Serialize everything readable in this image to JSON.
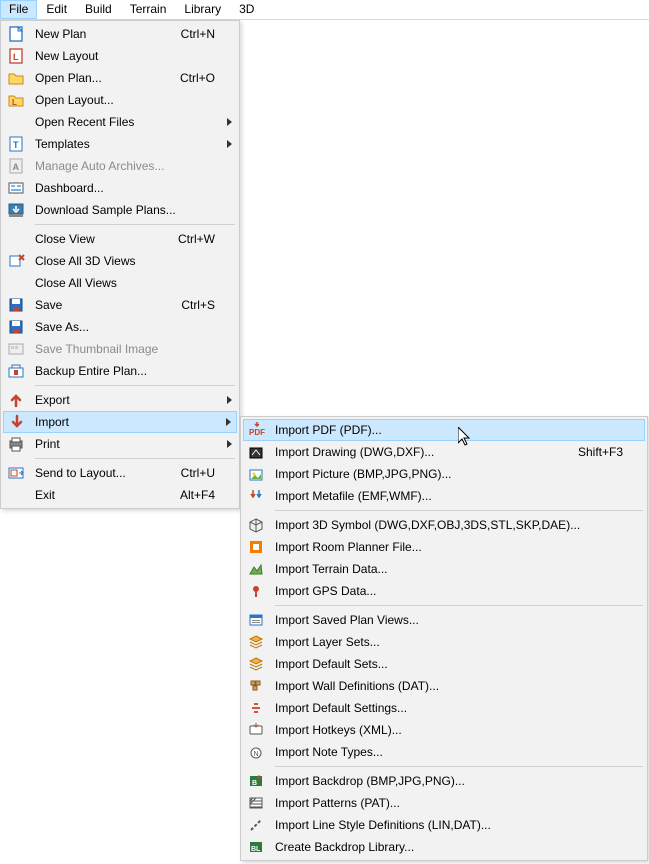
{
  "menubar": [
    "File",
    "Edit",
    "Build",
    "Terrain",
    "Library",
    "3D"
  ],
  "activeMenu": 0,
  "fileMenu": [
    {
      "t": "item",
      "icon": "new-plan",
      "label": "New Plan",
      "sc": "Ctrl+N"
    },
    {
      "t": "item",
      "icon": "new-layout",
      "label": "New Layout"
    },
    {
      "t": "item",
      "icon": "open-plan",
      "label": "Open Plan...",
      "sc": "Ctrl+O"
    },
    {
      "t": "item",
      "icon": "open-layout",
      "label": "Open Layout..."
    },
    {
      "t": "item",
      "label": "Open Recent Files",
      "sub": true
    },
    {
      "t": "item",
      "icon": "templates",
      "label": "Templates",
      "sub": true
    },
    {
      "t": "item",
      "icon": "auto-archive",
      "label": "Manage Auto Archives...",
      "disabled": true
    },
    {
      "t": "item",
      "icon": "dashboard",
      "label": "Dashboard..."
    },
    {
      "t": "item",
      "icon": "download",
      "label": "Download Sample Plans..."
    },
    {
      "t": "sep"
    },
    {
      "t": "item",
      "label": "Close View",
      "sc": "Ctrl+W"
    },
    {
      "t": "item",
      "icon": "close3d",
      "label": "Close All 3D Views"
    },
    {
      "t": "item",
      "label": "Close All Views"
    },
    {
      "t": "item",
      "icon": "save",
      "label": "Save",
      "sc": "Ctrl+S"
    },
    {
      "t": "item",
      "icon": "saveas",
      "label": "Save As..."
    },
    {
      "t": "item",
      "icon": "thumb",
      "label": "Save Thumbnail Image",
      "disabled": true
    },
    {
      "t": "item",
      "icon": "backup",
      "label": "Backup Entire Plan..."
    },
    {
      "t": "sep"
    },
    {
      "t": "item",
      "icon": "export",
      "label": "Export",
      "sub": true
    },
    {
      "t": "item",
      "icon": "import",
      "label": "Import",
      "sub": true,
      "hl": true
    },
    {
      "t": "item",
      "icon": "print",
      "label": "Print",
      "sub": true
    },
    {
      "t": "sep"
    },
    {
      "t": "item",
      "icon": "sendlayout",
      "label": "Send to Layout...",
      "sc": "Ctrl+U"
    },
    {
      "t": "item",
      "label": "Exit",
      "sc": "Alt+F4"
    }
  ],
  "importMenu": [
    {
      "t": "item",
      "icon": "imp-pdf",
      "label": "Import PDF (PDF)...",
      "hl": true
    },
    {
      "t": "item",
      "icon": "imp-dwg",
      "label": "Import Drawing (DWG,DXF)...",
      "sc": "Shift+F3"
    },
    {
      "t": "item",
      "icon": "imp-pic",
      "label": "Import Picture (BMP,JPG,PNG)..."
    },
    {
      "t": "item",
      "icon": "imp-meta",
      "label": "Import Metafile (EMF,WMF)..."
    },
    {
      "t": "sep"
    },
    {
      "t": "item",
      "icon": "imp-3d",
      "label": "Import 3D Symbol (DWG,DXF,OBJ,3DS,STL,SKP,DAE)..."
    },
    {
      "t": "item",
      "icon": "imp-room",
      "label": "Import Room Planner File..."
    },
    {
      "t": "item",
      "icon": "imp-terrain",
      "label": "Import Terrain Data..."
    },
    {
      "t": "item",
      "icon": "imp-gps",
      "label": "Import GPS Data..."
    },
    {
      "t": "sep"
    },
    {
      "t": "item",
      "icon": "imp-views",
      "label": "Import Saved Plan Views..."
    },
    {
      "t": "item",
      "icon": "imp-layers",
      "label": "Import Layer Sets..."
    },
    {
      "t": "item",
      "icon": "imp-defsets",
      "label": "Import Default Sets..."
    },
    {
      "t": "item",
      "icon": "imp-wall",
      "label": "Import Wall Definitions (DAT)..."
    },
    {
      "t": "item",
      "icon": "imp-defset",
      "label": "Import Default Settings..."
    },
    {
      "t": "item",
      "icon": "imp-hotkey",
      "label": "Import Hotkeys (XML)..."
    },
    {
      "t": "item",
      "icon": "imp-note",
      "label": "Import Note Types..."
    },
    {
      "t": "sep"
    },
    {
      "t": "item",
      "icon": "imp-backdrop",
      "label": "Import Backdrop (BMP,JPG,PNG)..."
    },
    {
      "t": "item",
      "icon": "imp-pattern",
      "label": "Import Patterns (PAT)..."
    },
    {
      "t": "item",
      "icon": "imp-line",
      "label": "Import Line Style Definitions (LIN,DAT)..."
    },
    {
      "t": "item",
      "icon": "imp-backdroplib",
      "label": "Create Backdrop Library..."
    }
  ]
}
